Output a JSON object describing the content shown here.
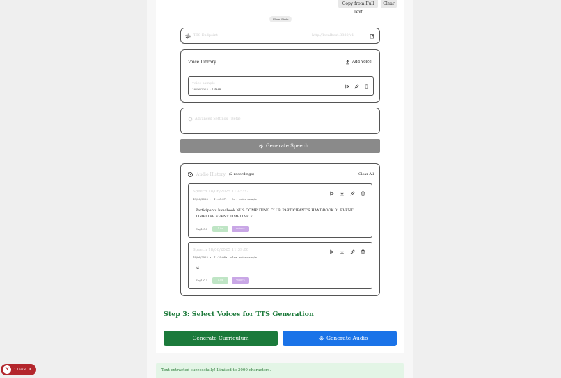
{
  "toolbar": {
    "copy_label": "Copy from Full Text",
    "clear_label": "Clear"
  },
  "show_stats_label": "Show Stats",
  "model_selector": {
    "label": "TTS Endpoint",
    "value": "http://localhost:8880/v1"
  },
  "voice_library": {
    "title": "Voice Library",
    "add_voice_label": "Add Voice",
    "voice": {
      "name": "voice-sample",
      "meta": "18/06/2025 • 1.4MB"
    }
  },
  "advanced_settings": {
    "label": "Advanced Settings",
    "hint": "(Beta)"
  },
  "generate_speech_label": "Generate Speech",
  "audio_history": {
    "title": "Audio History",
    "count": "(2 recordings)",
    "clear_all_label": "Clear All",
    "items": [
      {
        "title": "Speech 18/06/2025 11:45:37",
        "date": "18/06/2025",
        "time": "11:45:37",
        "duration": "~5s",
        "voice": "voice-sample",
        "text": "Participants handbook NUS COMPUTING CLUB PARTICIPANT'S HANDBOOK 01 EVENT TIMELINE EVENT TIMELINE E",
        "engine": "Engl. 0.5",
        "chip1": "1.0x",
        "chip2": "voice-s"
      },
      {
        "title": "Speech 18/06/2025 11:39:08",
        "date": "18/06/2025",
        "time": "11:39:08",
        "duration": "~1s",
        "voice": "voice-sample",
        "text": "hi",
        "engine": "Engl. 0.5",
        "chip1": "1.0x",
        "chip2": "voice-s"
      }
    ]
  },
  "step3_title": "Step 3: Select Voices for TTS Generation",
  "generate_curriculum_label": "Generate Curriculum",
  "generate_audio_label": "Generate Audio",
  "toast_text": "Text extracted successfully! Limited to 3000 characters.",
  "issue_badge": {
    "letter": "N",
    "label": "1 Issue"
  },
  "colors": {
    "green": "#1b7a3b",
    "blue": "#1a73e8",
    "grey_button": "#8a8a8a",
    "chip_green": "#bfe5c5",
    "chip_purple": "#c9a7e6",
    "issue_red": "#b3262c"
  }
}
